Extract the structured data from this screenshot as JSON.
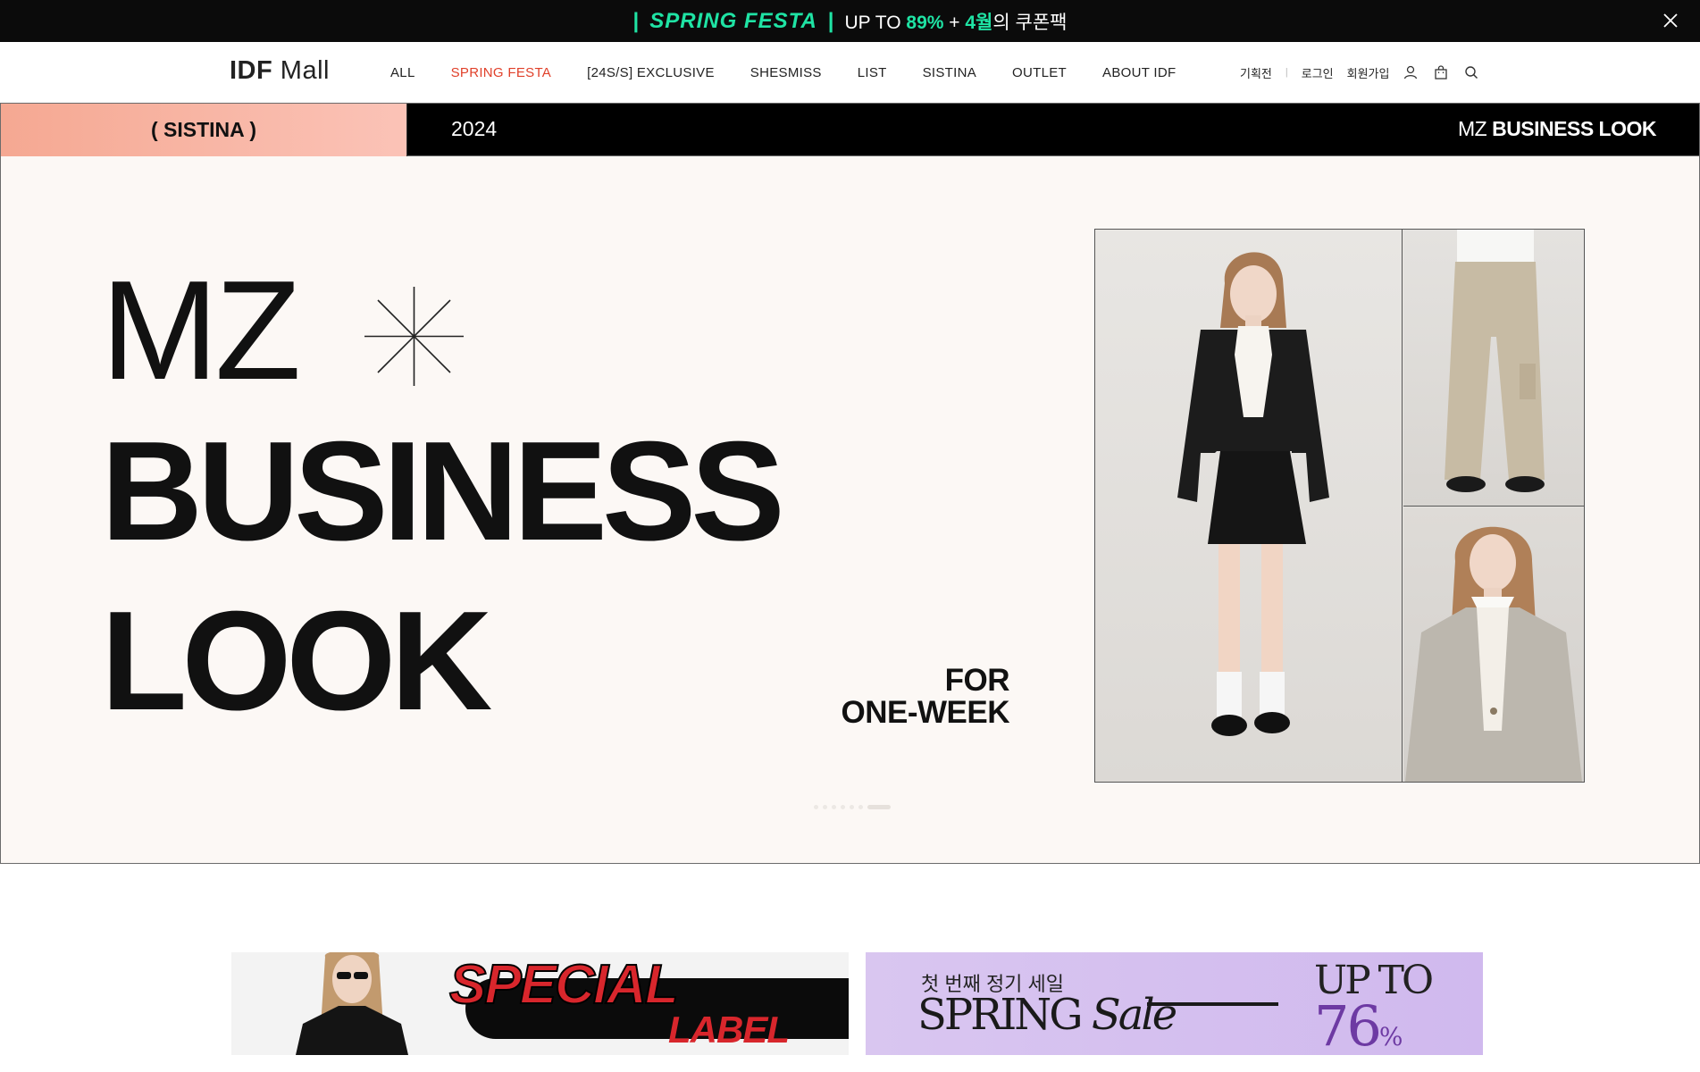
{
  "promo": {
    "pipe_left": "|",
    "festa": "SPRING FESTA",
    "pipe_right": "|",
    "upto": "UP TO",
    "percent": "89%",
    "plus": "+",
    "month": "4월",
    "coupon": "의 쿠폰팩",
    "close_icon": "close-icon"
  },
  "header": {
    "logo_bold": "IDF",
    "logo_light": "Mall",
    "nav": [
      "ALL",
      "SPRING FESTA",
      "[24S/S] EXCLUSIVE",
      "SHESMISS",
      "LIST",
      "SISTINA",
      "OUTLET",
      "ABOUT IDF"
    ],
    "active_nav": "SPRING FESTA",
    "util": {
      "exhibition": "기획전",
      "separator": "|",
      "login": "로그인",
      "signup": "회원가입",
      "icons": [
        "user-icon",
        "shopping-bag-icon",
        "search-icon"
      ]
    }
  },
  "hero": {
    "strip": {
      "brand": "( SISTINA )",
      "year": "2024",
      "title_light": "MZ",
      "title_bold": "BUSINESS LOOK"
    },
    "line1": "MZ",
    "line2": "BUSINESS",
    "line3": "LOOK",
    "for_line1": "FOR",
    "for_line2": "ONE-WEEK",
    "slide_count": 7,
    "active_slide": 7
  },
  "banners": {
    "special": {
      "word1": "SPECIAL",
      "word2": "LABEL"
    },
    "spring": {
      "sub": "첫 번째 정기 세일",
      "main_a": "SPRING",
      "main_b": "Sale",
      "upto": "UP TO",
      "pct": "76",
      "pct_sign": "%"
    }
  },
  "colors": {
    "accent_green": "#1fe3a4",
    "nav_active": "#e0402a",
    "special_red": "#d8262c",
    "spring_purple": "#6d3aa3"
  }
}
